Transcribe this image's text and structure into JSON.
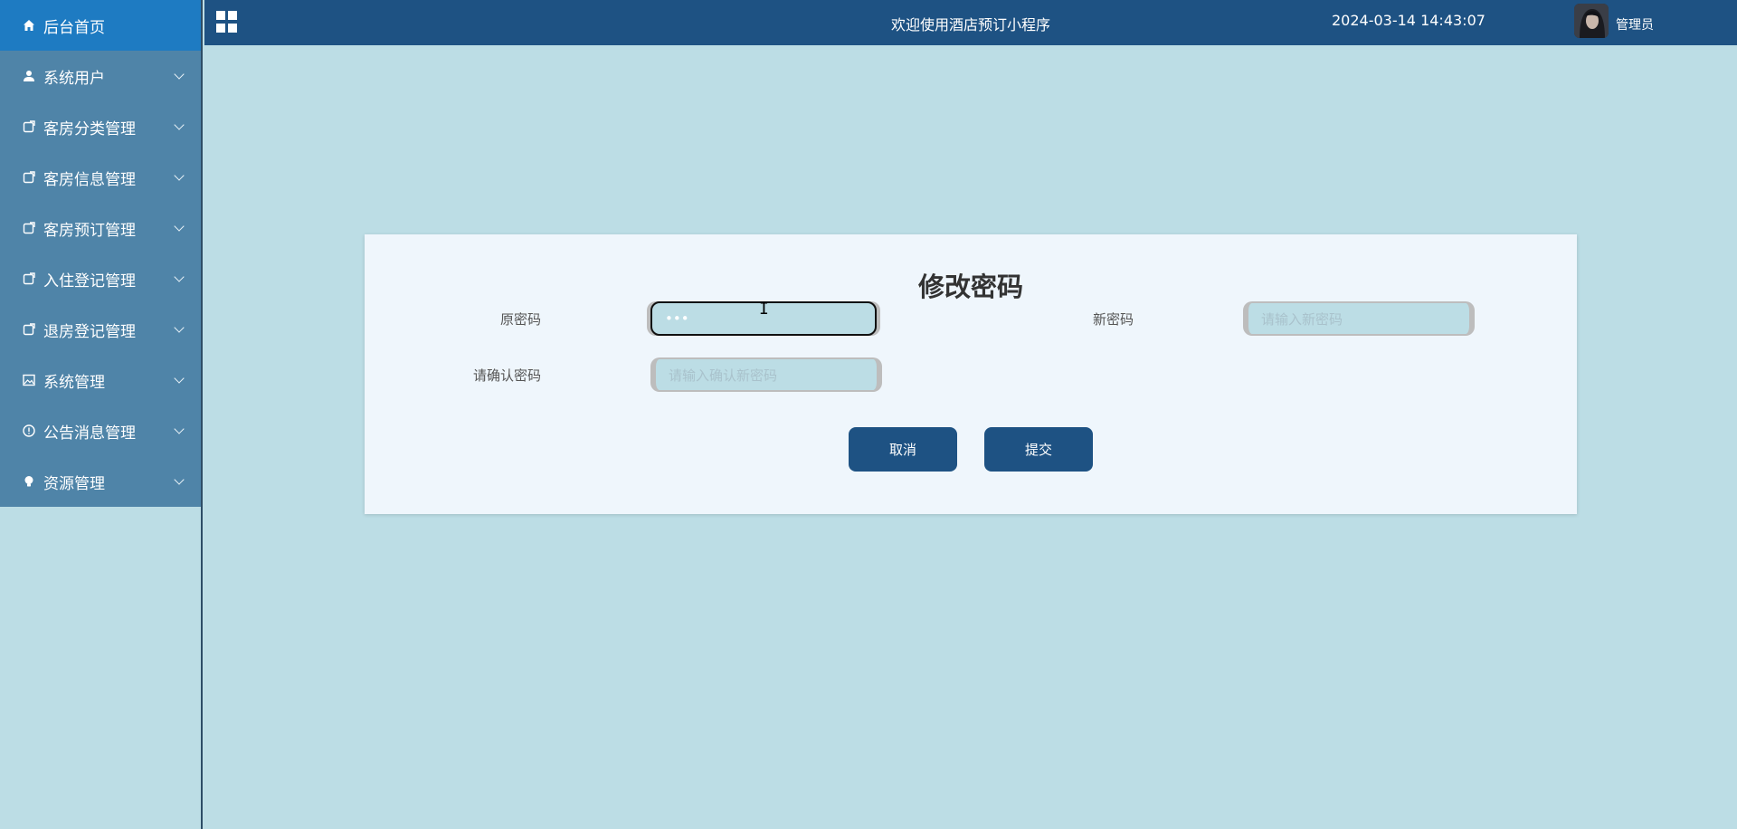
{
  "topbar": {
    "app_title": "欢迎使用酒店预订小程序",
    "datetime": "2024-03-14 14:43:07",
    "user_name": "管理员"
  },
  "sidebar": {
    "items": [
      {
        "label": "后台首页",
        "icon": "home-icon",
        "active": true,
        "has_submenu": false
      },
      {
        "label": "系统用户",
        "icon": "user-icon",
        "active": false,
        "has_submenu": true
      },
      {
        "label": "客房分类管理",
        "icon": "edit-icon",
        "active": false,
        "has_submenu": true
      },
      {
        "label": "客房信息管理",
        "icon": "edit-icon",
        "active": false,
        "has_submenu": true
      },
      {
        "label": "客房预订管理",
        "icon": "edit-icon",
        "active": false,
        "has_submenu": true
      },
      {
        "label": "入住登记管理",
        "icon": "edit-icon",
        "active": false,
        "has_submenu": true
      },
      {
        "label": "退房登记管理",
        "icon": "edit-icon",
        "active": false,
        "has_submenu": true
      },
      {
        "label": "系统管理",
        "icon": "picture-icon",
        "active": false,
        "has_submenu": true
      },
      {
        "label": "公告消息管理",
        "icon": "info-icon",
        "active": false,
        "has_submenu": true
      },
      {
        "label": "资源管理",
        "icon": "bulb-icon",
        "active": false,
        "has_submenu": true
      }
    ]
  },
  "form": {
    "title": "修改密码",
    "old_password": {
      "label": "原密码",
      "value": "•••"
    },
    "new_password": {
      "label": "新密码",
      "placeholder": "请输入新密码"
    },
    "confirm_password": {
      "label": "请确认密码",
      "placeholder": "请输入确认新密码"
    },
    "cancel_label": "取消",
    "submit_label": "提交"
  },
  "colors": {
    "sidebar_bg": "#4f84a8",
    "active_item": "#1e7bc2",
    "topbar": "#1e5283",
    "page_bg": "#bcdde5",
    "card_bg": "#eff6fc"
  }
}
